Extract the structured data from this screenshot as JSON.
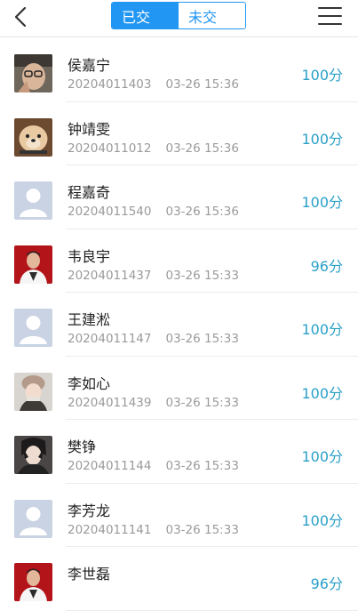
{
  "header": {
    "tabs": [
      {
        "label": "已交",
        "active": true
      },
      {
        "label": "未交",
        "active": false
      }
    ],
    "icons": {
      "back": "chevron-left-icon",
      "menu": "hamburger-menu-icon"
    }
  },
  "colors": {
    "accent": "#2196f3",
    "score": "#2aa0c8"
  },
  "students": [
    {
      "name": "侯嘉宁",
      "id": "20204011403",
      "time": "03-26 15:36",
      "score": "100分",
      "avatar": "photo-person-glasses"
    },
    {
      "name": "钟靖雯",
      "id": "20204011012",
      "time": "03-26 15:36",
      "score": "100分",
      "avatar": "photo-dog"
    },
    {
      "name": "程嘉奇",
      "id": "20204011540",
      "time": "03-26 15:36",
      "score": "100分",
      "avatar": "default-avatar"
    },
    {
      "name": "韦良宇",
      "id": "20204011437",
      "time": "03-26 15:33",
      "score": "96分",
      "avatar": "photo-person-red"
    },
    {
      "name": "王建淞",
      "id": "20204011147",
      "time": "03-26 15:33",
      "score": "100分",
      "avatar": "default-avatar"
    },
    {
      "name": "李如心",
      "id": "20204011439",
      "time": "03-26 15:33",
      "score": "100分",
      "avatar": "photo-girl-hat"
    },
    {
      "name": "樊铮",
      "id": "20204011144",
      "time": "03-26 15:33",
      "score": "100分",
      "avatar": "photo-anime"
    },
    {
      "name": "李芳龙",
      "id": "20204011141",
      "time": "03-26 15:33",
      "score": "100分",
      "avatar": "default-avatar"
    },
    {
      "name": "李世磊",
      "id": "",
      "time": "",
      "score": "96分",
      "avatar": "photo-person-red"
    }
  ]
}
